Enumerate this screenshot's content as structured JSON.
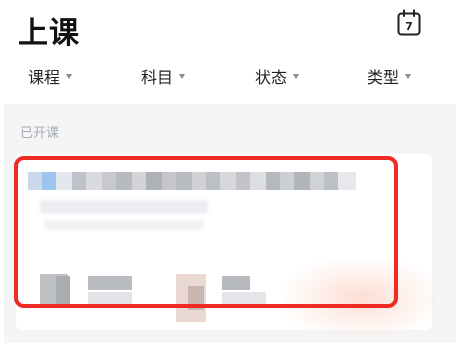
{
  "header": {
    "title": "上课",
    "calendar_day": "7",
    "calendar_icon": "calendar-icon"
  },
  "filters": [
    {
      "label": "课程"
    },
    {
      "label": "科目"
    },
    {
      "label": "状态"
    },
    {
      "label": "类型"
    }
  ],
  "section": {
    "label": "已开课"
  },
  "course_card": {
    "redacted": true,
    "highlight_color": "#ef2b23"
  },
  "colors": {
    "title": "#111111",
    "filter_text": "#222222",
    "caret": "#8a8a8a",
    "content_bg": "#f4f5f7",
    "section_label": "#a8acb3",
    "card_bg": "#ffffff",
    "highlight": "#ef2b23"
  }
}
